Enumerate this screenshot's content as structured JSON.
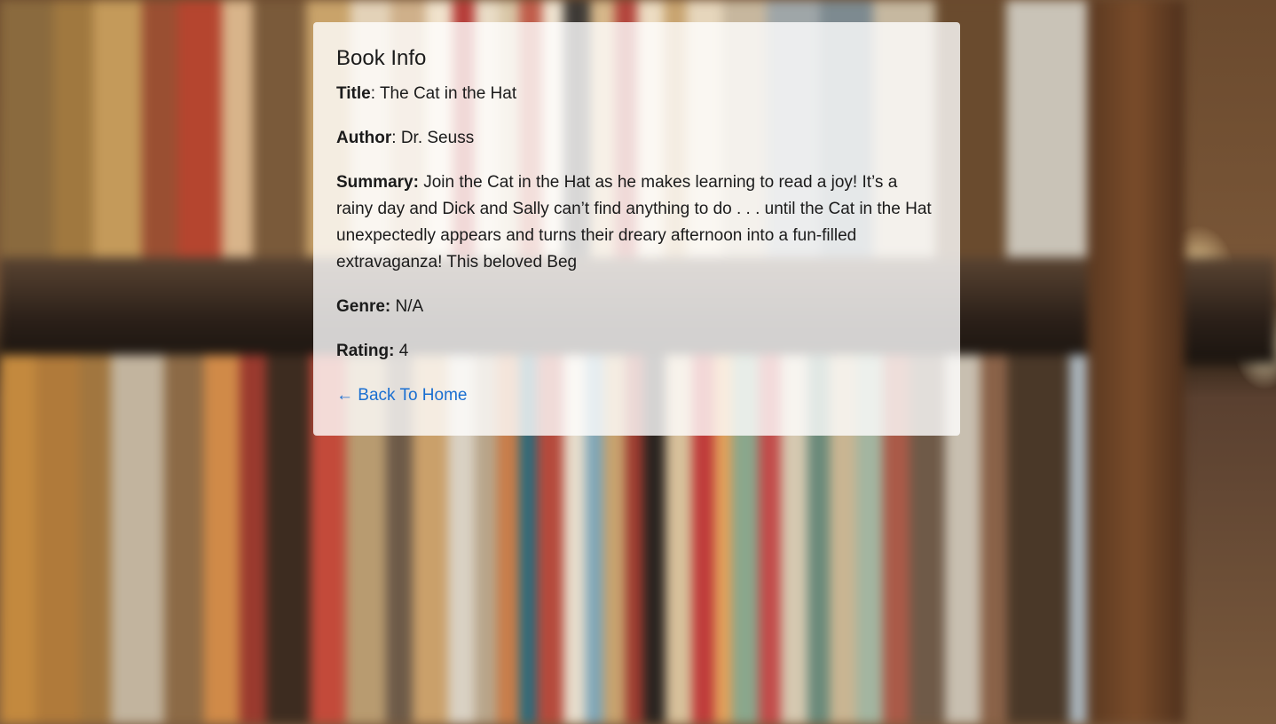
{
  "book_info": {
    "heading": "Book Info",
    "title_label": "Title",
    "title_sep": ": ",
    "title_value": "The Cat in the Hat",
    "author_label": "Author",
    "author_sep": ": ",
    "author_value": "Dr. Seuss",
    "summary_label": "Summary:",
    "summary_value": "Join the Cat in the Hat as he makes learning to read a joy! It’s a rainy day and Dick and Sally can’t find anything to do . . . until the Cat in the Hat unexpectedly appears and turns their dreary afternoon into a fun-filled extravaganza! This beloved Beg",
    "genre_label": "Genre:",
    "genre_value": "N/A",
    "rating_label": "Rating:",
    "rating_value": "4",
    "back_link_arrow": "←",
    "back_link_label": "Back To Home"
  },
  "colors": {
    "link": "#1a6fd1",
    "card_background": "rgba(255,255,255,0.80)"
  },
  "background": {
    "icon": "library-bookshelf-photo"
  }
}
